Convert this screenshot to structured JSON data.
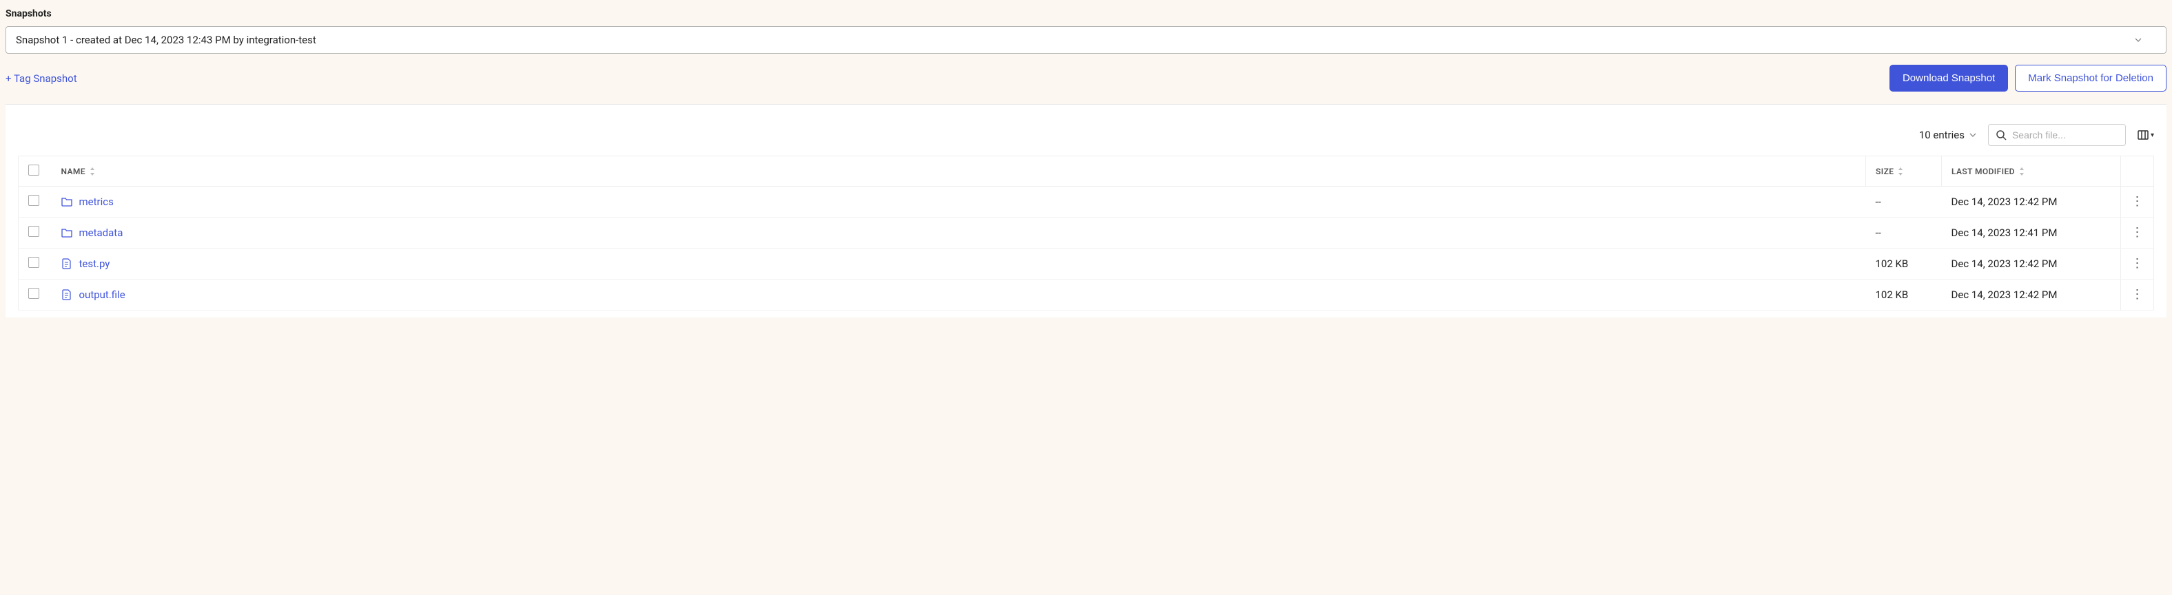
{
  "section_title": "Snapshots",
  "snapshot_select": {
    "value": "Snapshot 1 - created at Dec 14, 2023 12:43 PM by integration-test"
  },
  "tag_link": "+ Tag Snapshot",
  "buttons": {
    "download": "Download Snapshot",
    "mark_delete": "Mark Snapshot for Deletion"
  },
  "toolbar": {
    "entries_label": "10 entries",
    "search_placeholder": "Search file..."
  },
  "columns": {
    "name": "Name",
    "size": "Size",
    "last_modified": "Last Modified"
  },
  "rows": [
    {
      "type": "folder",
      "name": "metrics",
      "size": "--",
      "modified": "Dec 14, 2023 12:42 PM"
    },
    {
      "type": "folder",
      "name": "metadata",
      "size": "--",
      "modified": "Dec 14, 2023 12:41 PM"
    },
    {
      "type": "file",
      "name": "test.py",
      "size": "102 KB",
      "modified": "Dec 14, 2023 12:42 PM"
    },
    {
      "type": "file",
      "name": "output.file",
      "size": "102 KB",
      "modified": "Dec 14, 2023 12:42 PM"
    }
  ]
}
